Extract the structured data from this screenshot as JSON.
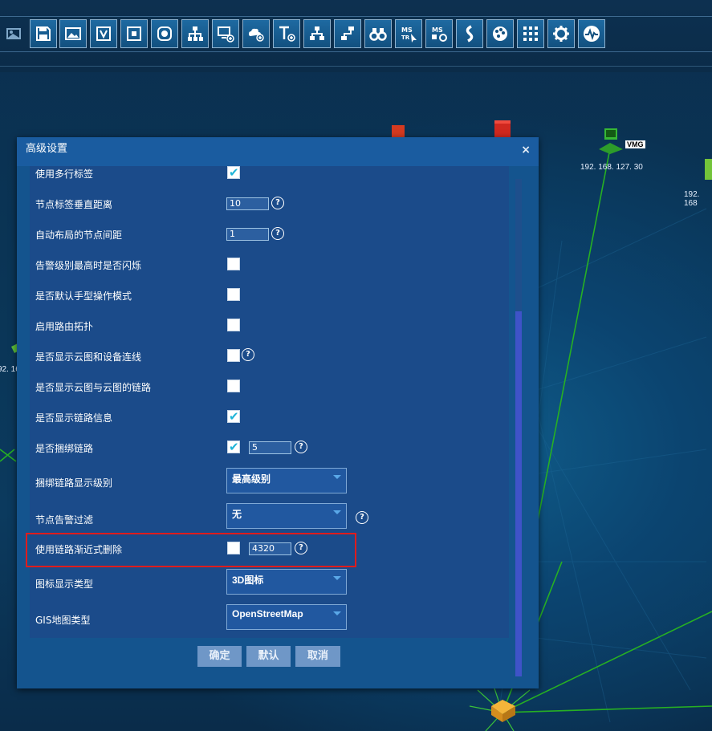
{
  "toolbar": {
    "buttons": [
      {
        "icon": "image-settings-icon"
      },
      {
        "icon": "save-icon"
      },
      {
        "icon": "picture-icon"
      },
      {
        "icon": "v-badge-icon"
      },
      {
        "icon": "frame-square-icon"
      },
      {
        "icon": "frame-circle-icon"
      },
      {
        "icon": "hierarchy-icon"
      },
      {
        "icon": "monitor-add-icon"
      },
      {
        "icon": "cloud-add-icon"
      },
      {
        "icon": "text-add-icon"
      },
      {
        "icon": "topology-add-icon"
      },
      {
        "icon": "pipe-link-icon"
      },
      {
        "icon": "binoculars-icon"
      },
      {
        "icon": "ms-tr-icon",
        "text": "MS TR"
      },
      {
        "icon": "ms-settings-icon",
        "text": "MS"
      },
      {
        "icon": "route-icon"
      },
      {
        "icon": "palette-icon"
      },
      {
        "icon": "grid-icon"
      },
      {
        "icon": "gear-icon"
      },
      {
        "icon": "monitor-pulse-icon"
      }
    ]
  },
  "map": {
    "node_labels": [
      {
        "name": "vmg-label",
        "text": "VMG"
      },
      {
        "name": "node-ip-1",
        "text": "192. 168. 127. 30"
      },
      {
        "name": "node-ip-2",
        "text": "192. 168"
      },
      {
        "name": "node-ip-3",
        "text": "92. 16"
      }
    ]
  },
  "dialog": {
    "title": "高级设置",
    "close": "×",
    "rows": [
      {
        "label": "使用多行标签"
      },
      {
        "label": "节点标签垂直距离",
        "value": "10"
      },
      {
        "label": "自动布局的节点间距",
        "value": "1"
      },
      {
        "label": "告警级别最高时是否闪烁"
      },
      {
        "label": "是否默认手型操作模式"
      },
      {
        "label": "启用路由拓扑"
      },
      {
        "label": "是否显示云图和设备连线"
      },
      {
        "label": "是否显示云图与云图的链路"
      },
      {
        "label": "是否显示链路信息"
      },
      {
        "label": "是否捆绑链路",
        "value": "5"
      },
      {
        "label": "捆绑链路显示级别",
        "select": "最高级别"
      },
      {
        "label": "节点告警过滤",
        "select": "无"
      },
      {
        "label": "使用链路渐近式删除",
        "value": "4320"
      },
      {
        "label": "图标显示类型",
        "select": "3D图标"
      },
      {
        "label": "GIS地图类型",
        "select": "OpenStreetMap"
      }
    ],
    "help": "?",
    "check": "✔",
    "buttons": {
      "ok": "确定",
      "default": "默认",
      "cancel": "取消"
    }
  }
}
